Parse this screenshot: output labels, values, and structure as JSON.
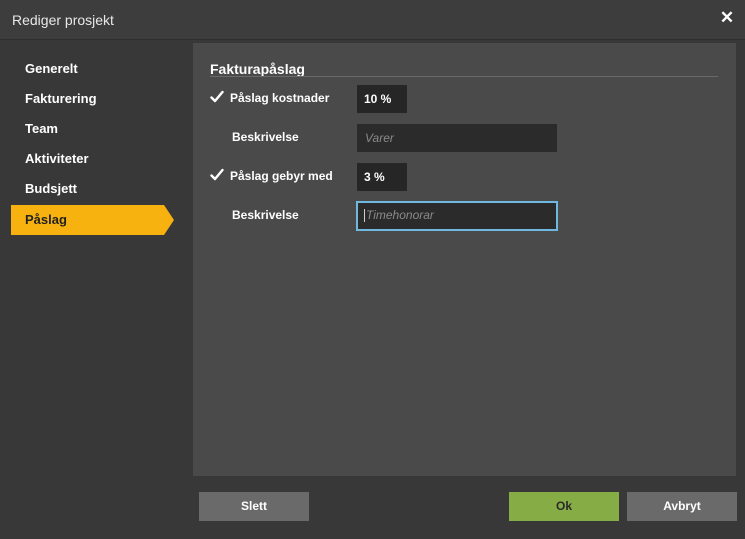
{
  "dialog": {
    "title": "Rediger prosjekt",
    "close_icon": "close-icon"
  },
  "sidebar": {
    "items": [
      {
        "label": "Generelt",
        "active": false
      },
      {
        "label": "Fakturering",
        "active": false
      },
      {
        "label": "Team",
        "active": false
      },
      {
        "label": "Aktiviteter",
        "active": false
      },
      {
        "label": "Budsjett",
        "active": false
      },
      {
        "label": "Påslag",
        "active": true
      }
    ],
    "active_color": "#f8b20f"
  },
  "section": {
    "title": "Fakturapåslag"
  },
  "markup_costs": {
    "checked": true,
    "label": "Påslag kostnader",
    "value": "10 %",
    "description_label": "Beskrivelse",
    "description_placeholder": "Varer"
  },
  "markup_fees": {
    "checked": true,
    "label": "Påslag gebyr med",
    "value": "3 %",
    "description_label": "Beskrivelse",
    "description_placeholder": "Timehonorar"
  },
  "footer": {
    "delete_label": "Slett",
    "ok_label": "Ok",
    "cancel_label": "Avbryt",
    "ok_color": "#86ad45"
  }
}
